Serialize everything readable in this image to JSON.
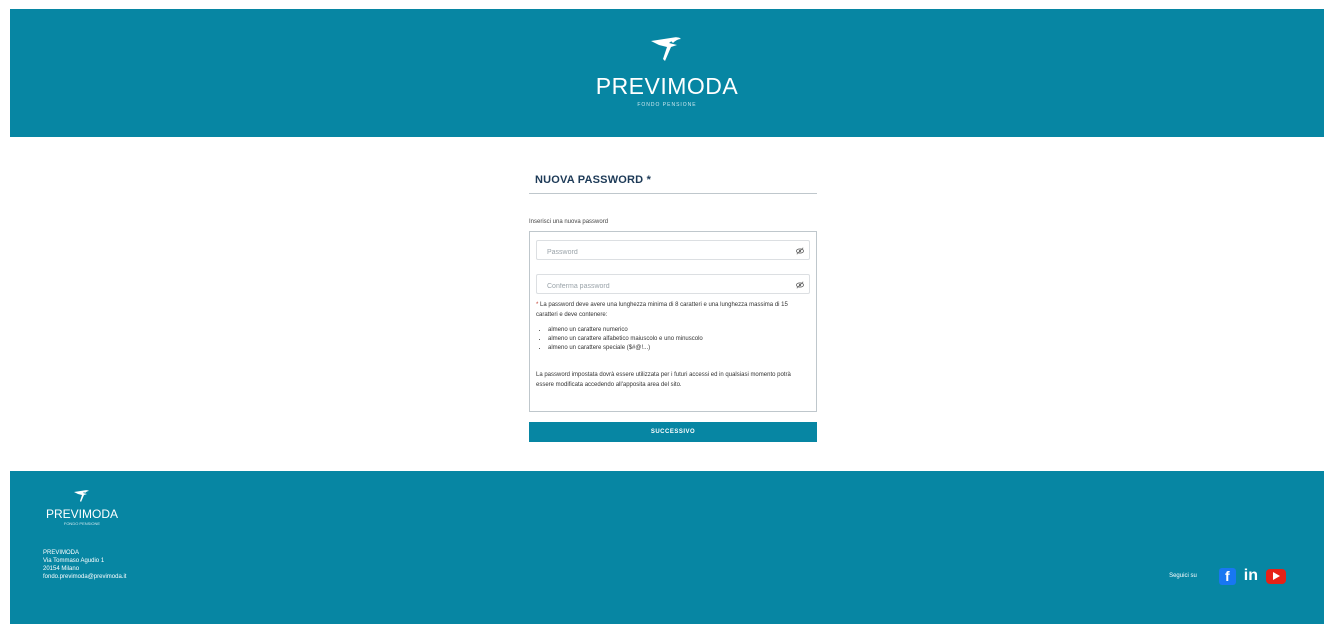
{
  "header": {
    "brand": "PREVIMODA",
    "tagline": "FONDO PENSIONE"
  },
  "form": {
    "title": "NUOVA PASSWORD",
    "required_mark": "*",
    "subtitle": "Inserisci una nuova password",
    "password": {
      "placeholder": "Password",
      "value": ""
    },
    "confirm": {
      "placeholder": "Conferma password",
      "value": ""
    },
    "rules_intro_star": "*",
    "rules_intro": "La password deve avere una lunghezza minima di 8 caratteri e una lunghezza massima di 15 caratteri e deve contenere:",
    "rules": [
      "almeno un carattere numerico",
      "almeno un carattere alfabetico maiuscolo e uno minuscolo",
      "almeno un carattere speciale ($#@!...)"
    ],
    "note": "La password impostata dovrà essere utilizzata per i futuri accessi ed in qualsiasi momento potrà essere modificata accedendo all'apposita area del sito.",
    "submit_label": "SUCCESSIVO"
  },
  "footer": {
    "brand": "PREVIMODA",
    "tagline": "FONDO PENSIONE",
    "address": [
      "PREVIMODA",
      "Via Tommaso Agudio 1",
      "20154 Milano",
      "fondo.previmoda@previmoda.it"
    ],
    "follow_label": "Seguici su",
    "social": {
      "facebook": "f",
      "linkedin": "in"
    }
  },
  "colors": {
    "brand": "#0786a3",
    "title": "#1d3a57",
    "youtube": "#e62117",
    "facebook": "#1877f2"
  }
}
